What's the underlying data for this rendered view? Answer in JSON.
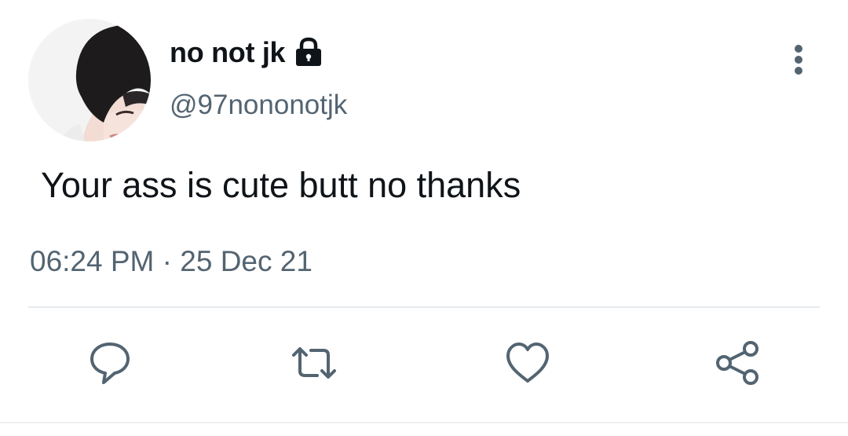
{
  "user": {
    "display_name": "no not jk",
    "handle": "@97nononotjk",
    "protected_icon": "lock-icon",
    "avatar": "profile-photo"
  },
  "tweet": {
    "text": "Your ass is cute butt no thanks",
    "time": "06:24 PM",
    "separator": "·",
    "date": "25 Dec 21"
  },
  "actions": [
    {
      "name": "reply",
      "icon": "speech-bubble-icon"
    },
    {
      "name": "retweet",
      "icon": "retweet-arrows-icon"
    },
    {
      "name": "like",
      "icon": "heart-icon"
    },
    {
      "name": "share",
      "icon": "share-nodes-icon"
    }
  ],
  "colors": {
    "text_primary": "#0f1419",
    "text_secondary": "#536471",
    "icon": "#536471",
    "divider": "#e6ebee"
  }
}
